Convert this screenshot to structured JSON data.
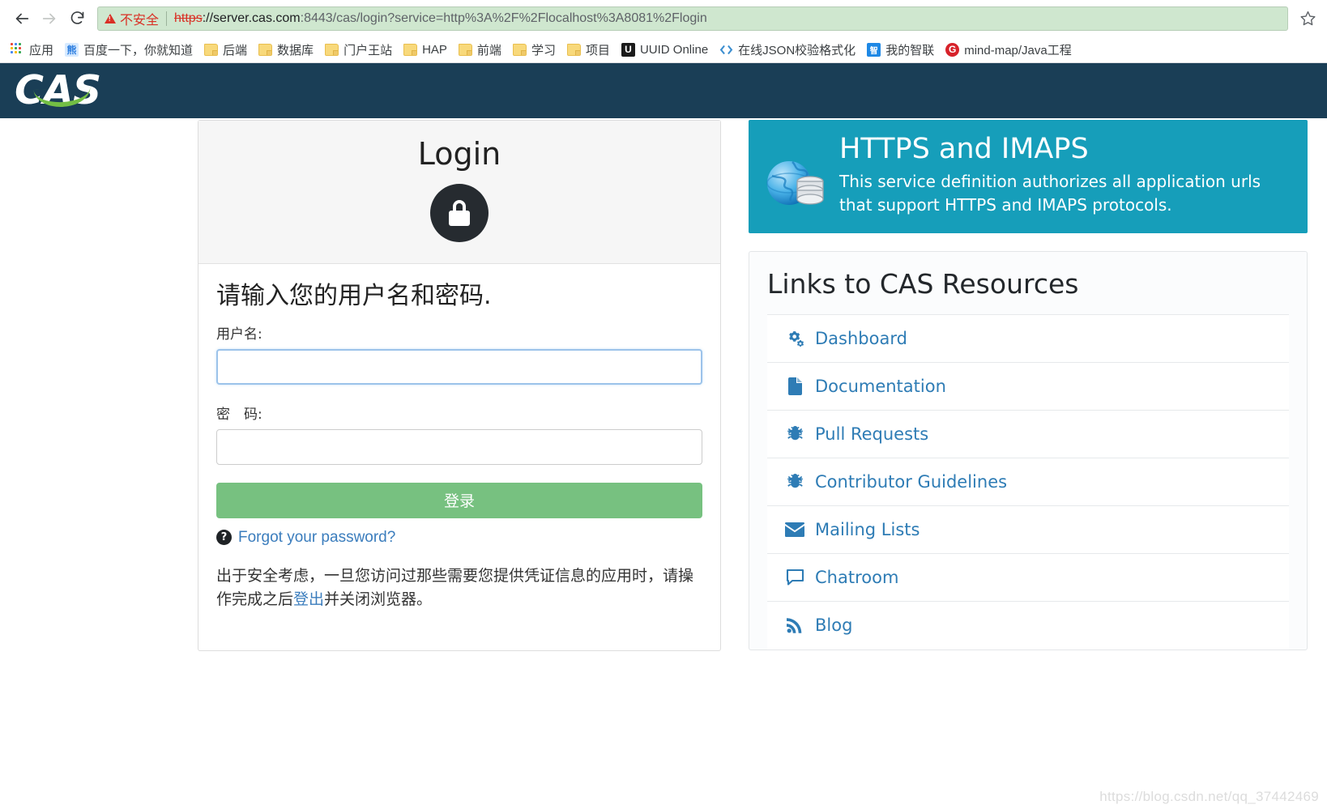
{
  "browser": {
    "nav": {
      "back_icon": "arrow-left-icon",
      "forward_icon": "arrow-right-icon",
      "reload_icon": "reload-icon",
      "bookmark_star_icon": "star-icon"
    },
    "omnibox": {
      "security_label": "不安全",
      "security_icon": "warning-triangle-icon",
      "url_scheme": "https",
      "url_rest": "://server.cas.com",
      "url_port": ":8443",
      "url_path": "/cas/login?service=http%3A%2F%2Flocalhost%3A8081%2Flogin",
      "full_url": "https://server.cas.com:8443/cas/login?service=http%3A%2F%2Flocalhost%3A8081%2Flogin"
    },
    "bookmarks": [
      {
        "label": "应用",
        "icon": "apps-grid-icon",
        "type": "apps"
      },
      {
        "label": "百度一下，你就知道",
        "icon": "baidu-icon",
        "type": "square",
        "color": "#2e7fe0",
        "glyph": "熊"
      },
      {
        "label": "后端",
        "icon": "folder-icon",
        "type": "folder"
      },
      {
        "label": "数据库",
        "icon": "folder-icon",
        "type": "folder"
      },
      {
        "label": "门户王站",
        "icon": "folder-icon",
        "type": "folder"
      },
      {
        "label": "HAP",
        "icon": "folder-icon",
        "type": "folder"
      },
      {
        "label": "前端",
        "icon": "folder-icon",
        "type": "folder"
      },
      {
        "label": "学习",
        "icon": "folder-icon",
        "type": "folder"
      },
      {
        "label": "项目",
        "icon": "folder-icon",
        "type": "folder"
      },
      {
        "label": "UUID Online",
        "icon": "uuid-icon",
        "type": "square",
        "color": "#1b1b1b",
        "glyph": "U"
      },
      {
        "label": "在线JSON校验格式化",
        "icon": "code-brackets-icon",
        "type": "code"
      },
      {
        "label": "我的智联",
        "icon": "zhaopin-icon",
        "type": "square",
        "color": "#1e88e5",
        "glyph": "智"
      },
      {
        "label": "mind-map/Java工程",
        "icon": "gitee-icon",
        "type": "circle",
        "color": "#d7222a",
        "glyph": "G"
      }
    ]
  },
  "site_header": {
    "logo_text": "CAS",
    "logo_name": "cas-logo",
    "background_color": "#1a3e56",
    "accent_color": "#73bf44"
  },
  "login": {
    "card_title": "Login",
    "lock_icon": "lock-icon",
    "prompt": "请输入您的用户名和密码.",
    "username_label": "用户名:",
    "username_value": "",
    "username_placeholder": "",
    "password_label": "密　码:",
    "password_value": "",
    "password_placeholder": "",
    "submit_label": "登录",
    "submit_color": "#77c180",
    "forgot_icon": "question-circle-icon",
    "forgot_label": "Forgot your password?",
    "notice_part1": "出于安全考虑，一旦您访问过那些需要您提供凭证信息的应用时，请操作完成之后",
    "notice_link": "登出",
    "notice_part2": "并关闭浏览器。"
  },
  "service_banner": {
    "title": "HTTPS and IMAPS",
    "description": "This service definition authorizes all application urls that support HTTPS and IMAPS protocols.",
    "icon": "globe-database-icon",
    "background_color": "#169eba"
  },
  "resources": {
    "title": "Links to CAS Resources",
    "link_color": "#2e7cb5",
    "items": [
      {
        "label": "Dashboard",
        "icon": "cogs-icon"
      },
      {
        "label": "Documentation",
        "icon": "file-icon"
      },
      {
        "label": "Pull Requests",
        "icon": "bug-icon"
      },
      {
        "label": "Contributor Guidelines",
        "icon": "bug-icon"
      },
      {
        "label": "Mailing Lists",
        "icon": "envelope-icon"
      },
      {
        "label": "Chatroom",
        "icon": "comment-icon"
      },
      {
        "label": "Blog",
        "icon": "rss-icon"
      }
    ]
  },
  "watermark": {
    "text": "https://blog.csdn.net/qq_37442469"
  }
}
